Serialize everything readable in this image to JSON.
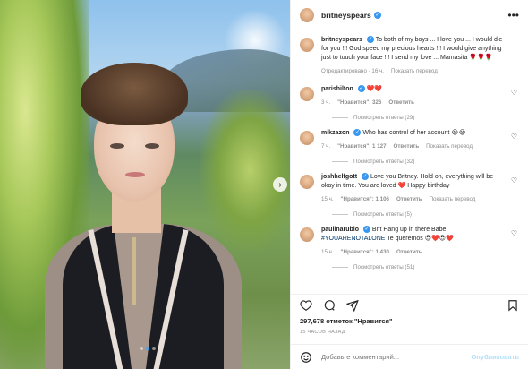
{
  "post": {
    "username": "britneyspears",
    "more_icon": "ellipsis-icon",
    "caption": {
      "user": "britneyspears",
      "text": "To both of my boys ... I love you ... I would die for you !!! God speed my precious hearts !!! I would give anything just to touch your face !!! I send my love ... Mamasita",
      "emoji": "🌹🌹🌹",
      "edited": "Отредактировано",
      "ago": "· 16 ч.",
      "translate": "Показать перевод"
    }
  },
  "comments": [
    {
      "user": "parishilton",
      "text": "",
      "emoji": "❤️❤️",
      "ago": "3 ч.",
      "likes": "\"Нравится\": 326",
      "reply": "Ответить",
      "replies": "Посмотреть ответы (29)",
      "translate": ""
    },
    {
      "user": "mikzazon",
      "text": "Who has control of her account",
      "emoji": "😭😭",
      "ago": "7 ч.",
      "likes": "\"Нравится\": 1 127",
      "reply": "Ответить",
      "replies": "Посмотреть ответы (32)",
      "translate": "Показать перевод"
    },
    {
      "user": "joshhelfgott",
      "text": "Love you Britney. Hold on, everything will be okay in time. You are loved",
      "emoji": "❤️",
      "extra": "Happy birthday",
      "ago": "15 ч.",
      "likes": "\"Нравится\": 1 106",
      "reply": "Ответить",
      "replies": "Посмотреть ответы (5)",
      "translate": "Показать перевод"
    },
    {
      "user": "paulinarubio",
      "text": "Brit Hang up in there Babe",
      "hashtag": "#YOUARENOTALONE",
      "text2": "Te queremos",
      "emoji": "😍❤️😍❤️",
      "ago": "15 ч.",
      "likes": "\"Нравится\": 1 430",
      "reply": "Ответить",
      "replies": "Посмотреть ответы (51)",
      "translate": ""
    }
  ],
  "actions": {
    "like_icon": "heart-icon",
    "comment_icon": "comment-icon",
    "share_icon": "share-icon",
    "save_icon": "bookmark-icon"
  },
  "likes_text": "297,678 отметок \"Нравится\"",
  "timestamp": "15 ЧАСОВ НАЗАД",
  "add_comment": {
    "placeholder": "Добавьте комментарий...",
    "publish": "Опубликовать",
    "emoji_icon": "smiley-icon"
  },
  "carousel": {
    "total": 3,
    "active": 2
  }
}
